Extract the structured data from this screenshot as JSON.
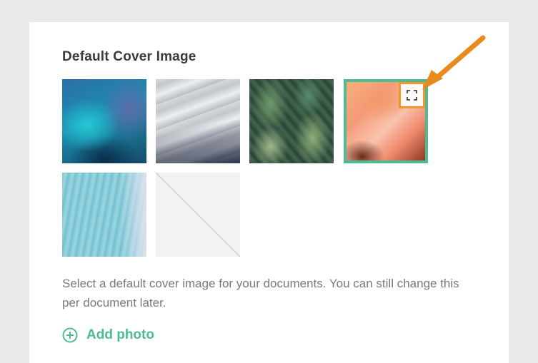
{
  "settings": {
    "section_title": "Default Cover Image",
    "description": "Select a default cover image for your documents. You can still change this per document later.",
    "add_photo_label": "Add photo",
    "cover_images": [
      {
        "name": "blue-aurora-blur",
        "selected": false
      },
      {
        "name": "grey-sand-dunes",
        "selected": false
      },
      {
        "name": "green-hosta-leaves",
        "selected": false
      },
      {
        "name": "orange-canyon",
        "selected": true
      },
      {
        "name": "turquoise-water",
        "selected": false
      },
      {
        "name": "no-image-placeholder",
        "selected": false
      }
    ]
  },
  "icons": {
    "expand": "expand-icon",
    "add": "plus-circle-icon",
    "annotation": "arrow-icon"
  },
  "colors": {
    "accent": "#4dbb93",
    "highlight": "#f0962a",
    "text_muted": "#7a7a7a",
    "title": "#3a3a3a"
  }
}
